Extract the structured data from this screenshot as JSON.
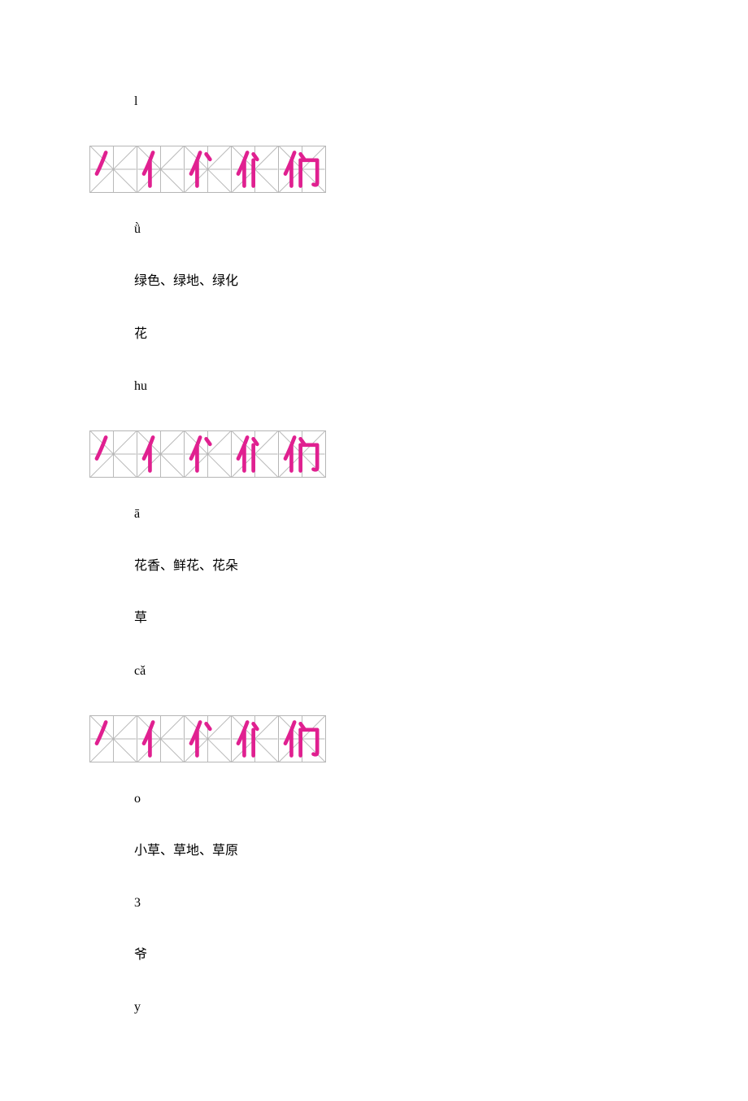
{
  "lines": {
    "l1": "l",
    "l2": "ǜ",
    "l3": "绿色、绿地、绿化",
    "l4": "花",
    "l5": "hu",
    "l6": "ā",
    "l7": "花香、鲜花、花朵",
    "l8": "草",
    "l9": "cǎ",
    "l10": "o",
    "l11": "小草、草地、草原",
    "l12": "3",
    "l13": "爷",
    "l14": "y"
  },
  "stroke_color": "#e02090",
  "grid_color": "#b6b6b6"
}
